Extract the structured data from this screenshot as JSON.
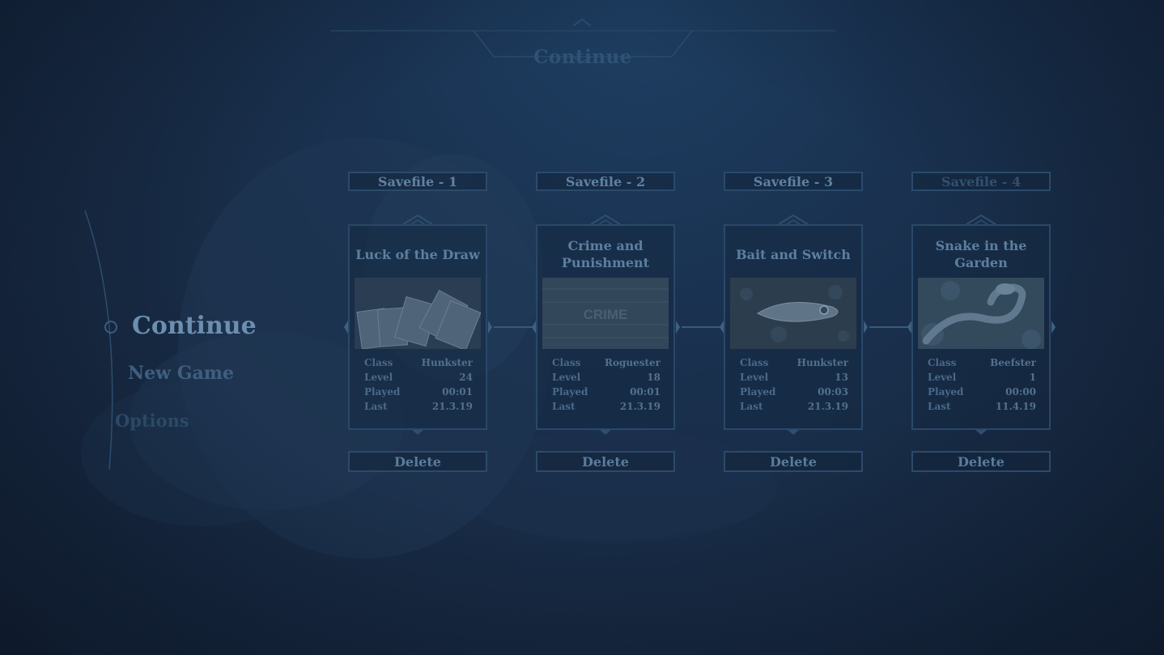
{
  "header": {
    "title": "Continue"
  },
  "menu": {
    "items": [
      {
        "label": "Continue",
        "state": "selected"
      },
      {
        "label": "New Game"
      },
      {
        "label": "Options"
      }
    ]
  },
  "colors": {
    "background": "#1a3352",
    "panel_border": "#2a4868",
    "text_primary": "#6c8eaf"
  },
  "stat_labels": {
    "class": "Class",
    "level": "Level",
    "played": "Played",
    "last": "Last"
  },
  "slots": [
    {
      "label": "Savefile - 1",
      "title": "Luck of the Draw",
      "image": "playing-cards-image",
      "class": "Hunkster",
      "level": "24",
      "played": "00:01",
      "last": "21.3.19",
      "delete_label": "Delete"
    },
    {
      "label": "Savefile - 2",
      "title": "Crime and Punishment",
      "image": "crime-sign-image",
      "image_text": "CRIME",
      "class": "Roguester",
      "level": "18",
      "played": "00:01",
      "last": "21.3.19",
      "delete_label": "Delete"
    },
    {
      "label": "Savefile - 3",
      "title": "Bait and Switch",
      "image": "fishing-lure-image",
      "class": "Hunkster",
      "level": "13",
      "played": "00:03",
      "last": "21.3.19",
      "delete_label": "Delete"
    },
    {
      "label": "Savefile - 4",
      "title": "Snake in the Garden",
      "image": "snake-image",
      "class": "Beefster",
      "level": "1",
      "played": "00:00",
      "last": "11.4.19",
      "delete_label": "Delete"
    }
  ]
}
